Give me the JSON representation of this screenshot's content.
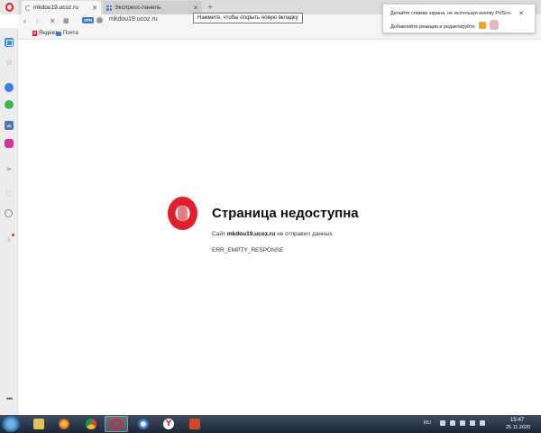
{
  "colors": {
    "opera_red": "#e0202b",
    "accent_blue": "#3a8de0",
    "taskbar": "#2a3547"
  },
  "tabs": [
    {
      "title": "mkdou19.ucoz.ru",
      "icon": "loading-spinner-icon",
      "active": true
    },
    {
      "title": "Экспресс-панель",
      "icon": "speed-dial-icon",
      "active": false
    }
  ],
  "tooltip": "Нажмите, чтобы открыть новую вкладку",
  "address_bar": {
    "vpn_badge": "VPN",
    "url": "mkdou19.ucoz.ru"
  },
  "bookmarks": [
    {
      "label": "Яндекс",
      "icon": "yandex-icon"
    },
    {
      "label": "Почта",
      "icon": "mail-icon"
    }
  ],
  "sidebar": {
    "items": [
      {
        "name": "home",
        "icon": "home-icon"
      },
      {
        "name": "bookmarks",
        "icon": "star-icon"
      },
      {
        "name": "messenger",
        "icon": "messenger-icon"
      },
      {
        "name": "whatsapp",
        "icon": "whatsapp-icon"
      },
      {
        "name": "vk",
        "icon": "vk-icon",
        "text": "VK"
      },
      {
        "name": "instagram",
        "icon": "instagram-icon"
      },
      {
        "name": "send",
        "icon": "send-icon"
      },
      {
        "name": "favorites",
        "icon": "heart-icon"
      },
      {
        "name": "history",
        "icon": "clock-icon"
      },
      {
        "name": "news",
        "icon": "bulb-icon"
      },
      {
        "name": "more",
        "icon": "more-icon"
      }
    ]
  },
  "error": {
    "title": "Страница недоступна",
    "desc_prefix": "Сайт",
    "site": "mkdou19.ucoz.ru",
    "desc_suffix": "не отправил данных.",
    "code": "ERR_EMPTY_RESPONSE"
  },
  "notification": {
    "line1": "Делайте снимки экрана, не используя кнопку PrtScn.",
    "line2": "Добавляйте реакции и редактируйте"
  },
  "taskbar": {
    "apps": [
      {
        "name": "explorer",
        "icon": "folder-icon"
      },
      {
        "name": "firefox",
        "icon": "firefox-icon"
      },
      {
        "name": "chrome",
        "icon": "chrome-icon"
      },
      {
        "name": "opera",
        "icon": "opera-icon"
      },
      {
        "name": "thunderbird",
        "icon": "thunderbird-icon"
      },
      {
        "name": "yandex",
        "icon": "yandex-browser-icon"
      },
      {
        "name": "powerpoint",
        "icon": "powerpoint-icon"
      }
    ],
    "language": "RU",
    "time": "15:47",
    "date": "25.11.2020"
  }
}
